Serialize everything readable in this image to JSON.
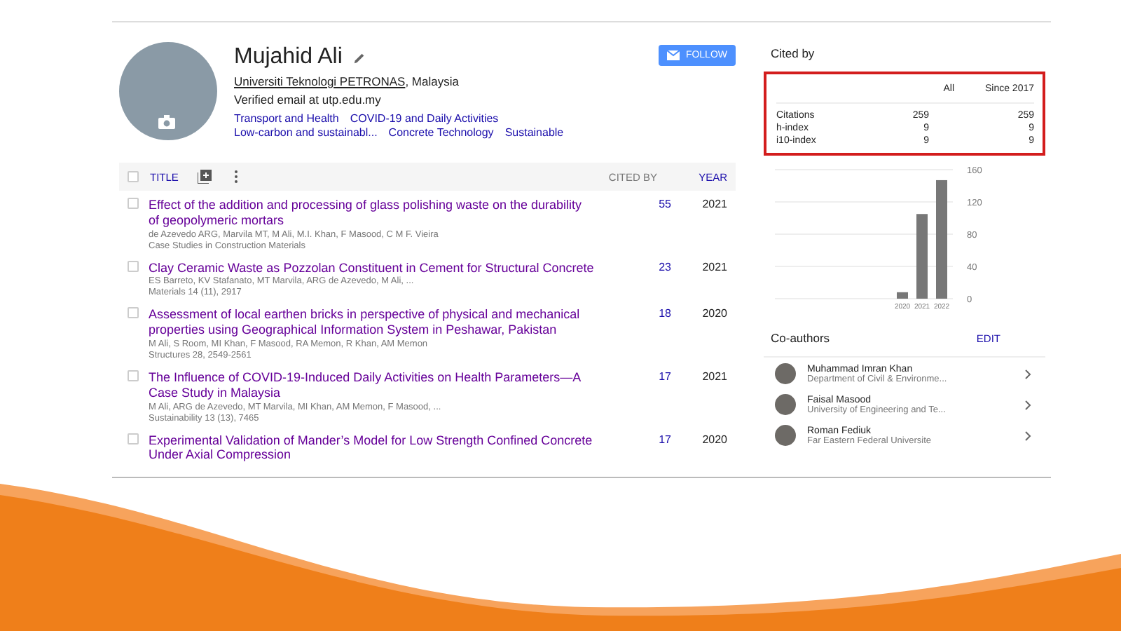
{
  "profile": {
    "name": "Mujahid Ali",
    "affiliation_link": "Universiti Teknologi PETRONAS",
    "affiliation_rest": ", Malaysia",
    "email": "Verified email at utp.edu.my",
    "interests": [
      "Transport and Health",
      "COVID-19 and Daily Activities",
      "Low-carbon and sustainabl...",
      "Concrete Technology",
      "Sustainable"
    ],
    "follow_button": "FOLLOW"
  },
  "table": {
    "select_all": {
      "checked": false
    },
    "columns": {
      "title": "TITLE",
      "cited_by": "CITED BY",
      "year": "YEAR"
    },
    "rows": [
      {
        "title": "Effect of the addition and processing of glass polishing waste on the durability of geopolymeric mortars",
        "authors": "de Azevedo ARG, Marvila MT, M Ali, M.I. Khan, F Masood, C M F. Vieira",
        "venue": "Case Studies in Construction Materials",
        "cited_by": "55",
        "year": "2021",
        "checked": false
      },
      {
        "title": "Clay Ceramic Waste as Pozzolan Constituent in Cement for Structural Concrete",
        "authors": "ES Barreto, KV Stafanato, MT Marvila, ARG de Azevedo, M Ali, ...",
        "venue": "Materials 14 (11), 2917",
        "cited_by": "23",
        "year": "2021",
        "checked": false
      },
      {
        "title": "Assessment of local earthen bricks in perspective of physical and mechanical properties using Geographical Information System in Peshawar, Pakistan",
        "authors": "M Ali, S Room, MI Khan, F Masood, RA Memon, R Khan, AM Memon",
        "venue": "Structures 28, 2549-2561",
        "cited_by": "18",
        "year": "2020",
        "checked": false
      },
      {
        "title": "The Influence of COVID-19-Induced Daily Activities on Health Parameters—A Case Study in Malaysia",
        "authors": "M Ali, ARG de Azevedo, MT Marvila, MI Khan, AM Memon, F Masood, ...",
        "venue": "Sustainability 13 (13), 7465",
        "cited_by": "17",
        "year": "2021",
        "checked": false
      },
      {
        "title": "Experimental Validation of Mander’s Model for Low Strength Confined Concrete Under Axial Compression",
        "cited_by": "17",
        "year": "2020",
        "checked": false
      }
    ]
  },
  "cited_by": {
    "title": "Cited by",
    "columns": [
      "All",
      "Since 2017"
    ],
    "rows": [
      {
        "label": "Citations",
        "all": "259",
        "since": "259"
      },
      {
        "label": "h-index",
        "all": "9",
        "since": "9"
      },
      {
        "label": "i10-index",
        "all": "9",
        "since": "9"
      }
    ],
    "chart_data": {
      "type": "bar",
      "categories": [
        "2020",
        "2021",
        "2022"
      ],
      "values": [
        8,
        105,
        147
      ],
      "ylim": [
        0,
        160
      ],
      "yticks": [
        0,
        40,
        80,
        120,
        160
      ],
      "grid": true
    }
  },
  "coauthors": {
    "title": "Co-authors",
    "edit": "EDIT",
    "items": [
      {
        "name": "Muhammad Imran Khan",
        "affiliation": "Department of Civil & Environme..."
      },
      {
        "name": "Faisal Masood",
        "affiliation": "University of Engineering and Te..."
      },
      {
        "name": "Roman Fediuk",
        "affiliation": "Far Eastern Federal Universite"
      }
    ]
  }
}
